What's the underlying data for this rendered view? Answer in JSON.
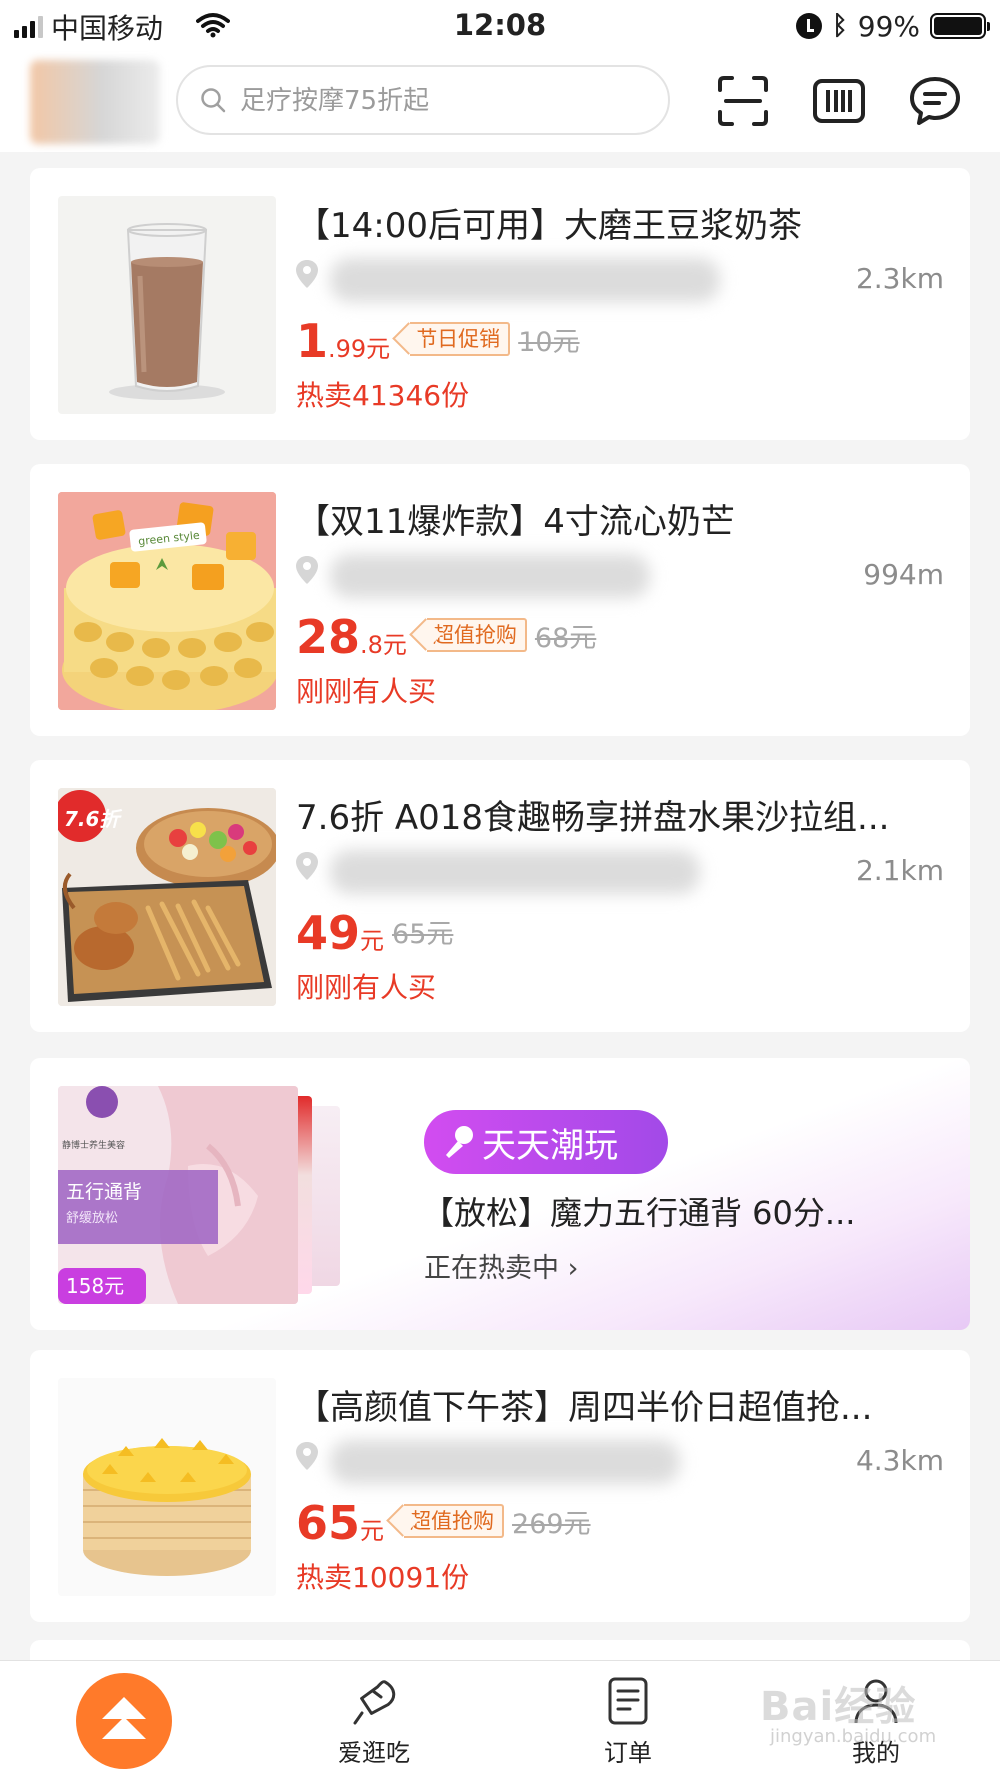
{
  "status_bar": {
    "carrier": "中国移动",
    "time": "12:08",
    "battery": "99%"
  },
  "search": {
    "placeholder": "足疗按摩75折起"
  },
  "header_icons": [
    "scan-icon",
    "barcode-icon",
    "message-icon"
  ],
  "deals": [
    {
      "title": "【14:00后可用】大磨王豆浆奶茶",
      "distance": "2.3km",
      "price_int": "1",
      "price_dec": ".99元",
      "tag": "节日促销",
      "original_price": "10元",
      "sales": "热卖41346份"
    },
    {
      "title": "【双11爆炸款】4寸流心奶芒",
      "distance": "994m",
      "price_int": "28",
      "price_dec": ".8元",
      "tag": "超值抢购",
      "original_price": "68元",
      "sales": "刚刚有人买"
    },
    {
      "title": "7.6折  A018食趣畅享拼盘水果沙拉组...",
      "distance": "2.1km",
      "price_int": "49",
      "price_dec": "元",
      "original_price": "65元",
      "sales": "刚刚有人买",
      "image_badge": "7.6折"
    },
    {
      "title": "【高颜值下午茶】周四半价日超值抢...",
      "distance": "4.3km",
      "price_int": "65",
      "price_dec": "元",
      "tag": "超值抢购",
      "original_price": "269元",
      "sales": "热卖10091份"
    }
  ],
  "promo": {
    "badge": "天天潮玩",
    "title": "【放松】魔力五行通背 60分...",
    "subtitle": "正在热卖中 ›",
    "image_heading": "五行通背",
    "image_sub": "舒缓放松",
    "image_price": "158元",
    "image_brand": "静博士养生美容"
  },
  "image_texts": {
    "cake_brand": "green style"
  },
  "tabbar": {
    "tab1": "爱逛吃",
    "tab2": "订单",
    "tab3": "我的"
  },
  "watermark": {
    "main": "Bai经验",
    "sub": "jingyan.baidu.com"
  },
  "colors": {
    "price_red": "#e83a26",
    "accent_orange": "#ff7a2a",
    "promo_purple": "#b04cec"
  }
}
